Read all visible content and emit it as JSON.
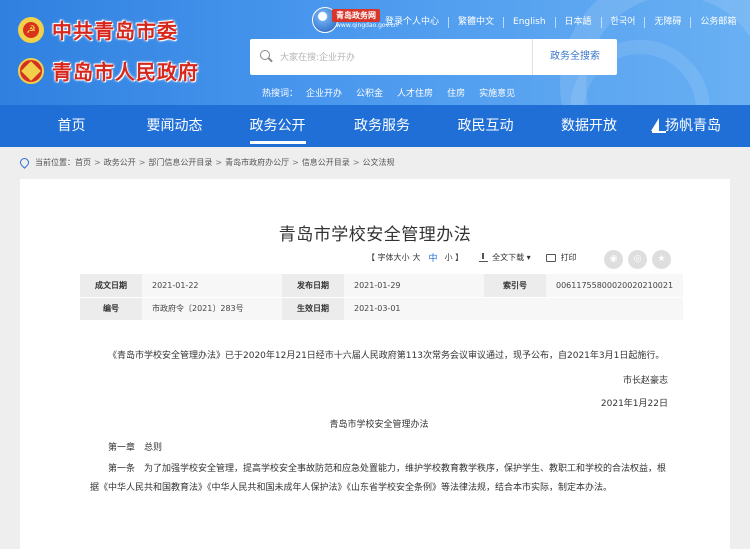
{
  "header": {
    "party_name": "中共青岛市委",
    "gov_name": "青岛市人民政府",
    "gov_net_logo_text": "青岛政务网",
    "gov_net_logo_sub": "www.qingdao.gov.cn",
    "top_links": [
      "登录个人中心",
      "繁體中文",
      "English",
      "日本語",
      "한국어",
      "无障碍",
      "公务邮箱"
    ],
    "search_placeholder": "大家在搜:企业开办",
    "search_button": "政务全搜索",
    "hotwords_label": "热搜词：",
    "hotwords": [
      "企业开办",
      "公积金",
      "人才住房",
      "住房",
      "实施意见"
    ]
  },
  "nav": {
    "items": [
      "首页",
      "要闻动态",
      "政务公开",
      "政务服务",
      "政民互动",
      "数据开放",
      "扬帆青岛"
    ],
    "active_index": 2
  },
  "breadcrumb": {
    "label": "当前位置：",
    "items": [
      "首页",
      "政务公开",
      "部门信息公开目录",
      "青岛市政府办公厅",
      "信息公开目录",
      "公文法规"
    ]
  },
  "doc": {
    "title": "青岛市学校安全管理办法",
    "toolbar": {
      "font_size_label": "【 字体大小",
      "large": "大",
      "medium": "中",
      "small": "小 】",
      "download": "全文下载 ▾",
      "print": "打印"
    },
    "meta": {
      "row1": {
        "k1": "成文日期",
        "v1": "2021-01-22",
        "k2": "发布日期",
        "v2": "2021-01-29",
        "k3": "索引号",
        "v3": "00611755800020020210021"
      },
      "row2": {
        "k1": "编号",
        "v1": "市政府令〔2021〕283号",
        "k2": "生效日期",
        "v2": "2021-03-01"
      }
    },
    "paragraphs": {
      "intro": "《青岛市学校安全管理办法》已于2020年12月21日经市十六届人民政府第113次常务会议审议通过，现予公布，自2021年3月1日起施行。",
      "signature": "市长赵豪志",
      "date": "2021年1月22日",
      "sub_title": "青岛市学校安全管理办法",
      "chapter": "第一章　总则",
      "article1": "第一条　为了加强学校安全管理，提高学校安全事故防范和应急处置能力，维护学校教育教学秩序，保护学生、教职工和学校的合法权益，根据《中华人民共和国教育法》《中华人民共和国未成年人保护法》《山东省学校安全条例》等法律法规，结合本市实际，制定本办法。"
    }
  }
}
